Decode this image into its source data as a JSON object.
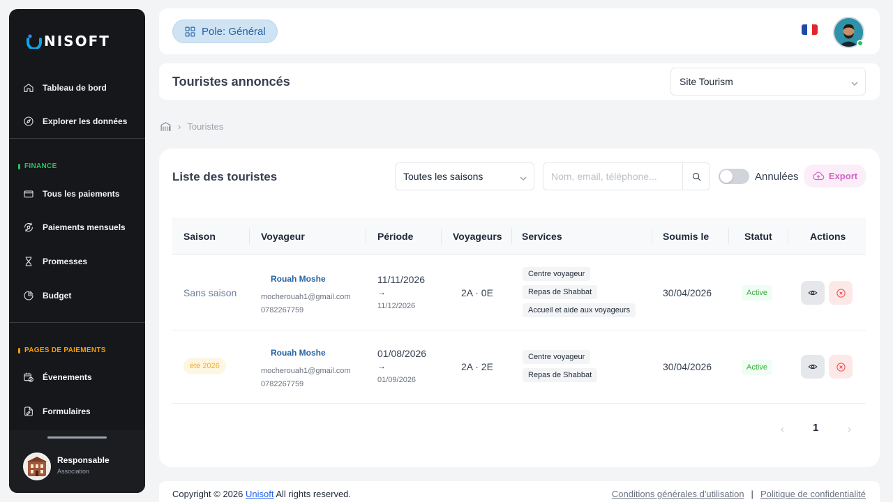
{
  "brand": {
    "name": "NISOFT"
  },
  "sidebar": {
    "top_items": [
      {
        "label": "Tableau de bord",
        "icon": "home-icon"
      },
      {
        "label": "Explorer les données",
        "icon": "compass-icon"
      }
    ],
    "finance": {
      "title": "FINANCE",
      "color": "#22c55e",
      "items": [
        {
          "label": "Tous les paiements",
          "icon": "credit-card-icon"
        },
        {
          "label": "Paiements mensuels",
          "icon": "refresh-icon"
        },
        {
          "label": "Promesses",
          "icon": "hourglass-icon"
        },
        {
          "label": "Budget",
          "icon": "pie-chart-icon"
        }
      ]
    },
    "payment_pages": {
      "title": "PAGES DE PAIEMENTS",
      "color": "#f59e0b",
      "items": [
        {
          "label": "Évenements",
          "icon": "calendar-clock-icon"
        },
        {
          "label": "Formulaires",
          "icon": "form-icon"
        }
      ]
    },
    "user": {
      "name": "Responsable",
      "role": "Association"
    }
  },
  "header": {
    "pole_label": "Pole: Général",
    "language": "fr-flag-icon"
  },
  "titlebar": {
    "title": "Touristes annoncés",
    "site_select": "Site Tourism"
  },
  "breadcrumb": {
    "current": "Touristes"
  },
  "list": {
    "title": "Liste des touristes",
    "season_filter": "Toutes les saisons",
    "search_placeholder": "Nom, email, téléphone...",
    "toggle_label": "Annulées",
    "toggle_on": false,
    "export_label": "Export",
    "columns": [
      "Saison",
      "Voyageur",
      "Période",
      "Voyageurs",
      "Services",
      "Soumis le",
      "Statut",
      "Actions"
    ],
    "rows": [
      {
        "saison": "Sans saison",
        "name": "Rouah Moshe",
        "email": "mocherouah1@gmail.com",
        "phone": "0782267759",
        "start": "11/11/2026",
        "arrow": "→",
        "end": "11/12/2026",
        "voyageurs": "2A · 0E",
        "services": [
          "Centre voyageur",
          "Repas de Shabbat",
          "Accueil et aide aux voyageurs"
        ],
        "submitted": "30/04/2026",
        "status": "Active"
      },
      {
        "saison": "été 2026",
        "name": "Rouah Moshe",
        "email": "mocherouah1@gmail.com",
        "phone": "0782267759",
        "start": "01/08/2026",
        "arrow": "→",
        "end": "01/09/2026",
        "voyageurs": "2A · 2E",
        "services": [
          "Centre voyageur",
          "Repas de Shabbat"
        ],
        "submitted": "30/04/2026",
        "status": "Active"
      }
    ],
    "pagination": {
      "prev": "‹",
      "current_page": "1",
      "next": "›"
    }
  },
  "footer": {
    "copyright_prefix": "Copyright © 2026",
    "brand_link": "Unisoft",
    "copyright_suffix": "All rights reserved.",
    "terms": "Conditions générales d'utilisation",
    "divider": "|",
    "privacy": "Politique de confidentialité"
  }
}
